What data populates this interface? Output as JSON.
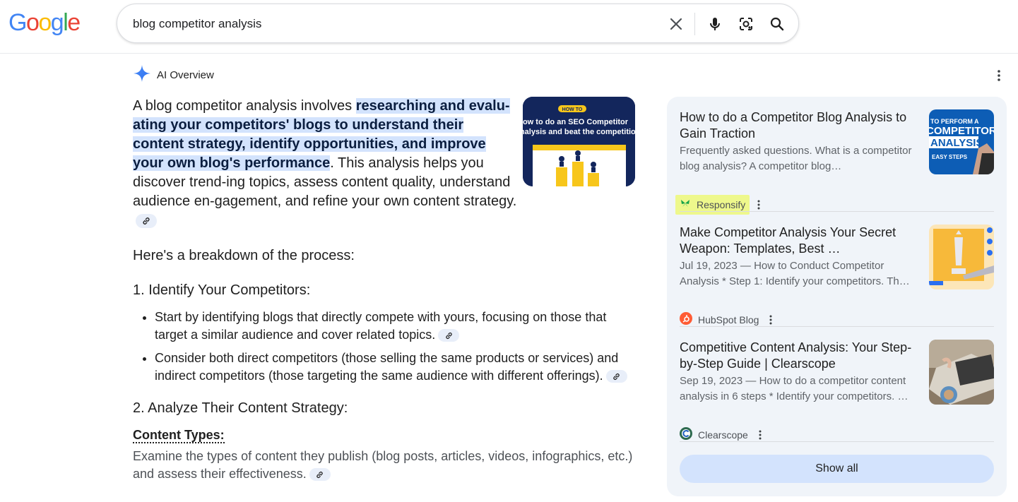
{
  "brand": {
    "logo_letters": [
      "G",
      "o",
      "o",
      "g",
      "l",
      "e"
    ],
    "logo_colors": [
      "#4285f4",
      "#ea4335",
      "#fbbc05",
      "#4285f4",
      "#34a853",
      "#ea4335"
    ]
  },
  "search": {
    "query": "blog competitor analysis",
    "icons": [
      "close-icon",
      "microphone-icon",
      "lens-icon",
      "search-icon"
    ]
  },
  "ai_overview": {
    "title": "AI Overview",
    "intro_prefix": "A blog competitor analysis involves ",
    "intro_highlight": "researching and evalu-ating your competitors' blogs to understand their content strategy, identify opportunities, and improve your own blog's performance",
    "intro_suffix": ". This analysis helps you discover trend-ing topics, assess content quality, understand audience en-gagement, and refine your own content strategy.",
    "breakdown_heading": "Here's a breakdown of the process:",
    "step1_heading": "1. Identify Your Competitors:",
    "step1_bullets": [
      "Start by identifying blogs that directly compete with yours, focusing on those that target a similar audience and cover related topics.",
      "Consider both direct competitors (those selling the same products or services) and indirect competitors (those targeting the same audience with different offerings)."
    ],
    "step2_heading": "2. Analyze Their Content Strategy:",
    "content_types_heading": "Content Types:",
    "content_types_text": "Examine the types of content they publish (blog posts, articles, videos, infographics, etc.) and assess their effectiveness.",
    "image_text": {
      "badge": "HOW TO",
      "line1": "How to do an SEO Competitor",
      "line2": "Analysis and beat the competition"
    }
  },
  "sources": [
    {
      "title": "How to do a Competitor Blog Analysis to Gain Traction",
      "snippet": "Frequently asked questions. What is a competitor blog analysis? A competitor blog…",
      "source": "Responsify",
      "thumb_text": [
        "TO PERFORM A",
        "COMPETITOR",
        "ANALYSIS",
        "EASY STEPS"
      ]
    },
    {
      "title": "Make Competitor Analysis Your Secret Weapon: Templates, Best …",
      "snippet": "Jul 19, 2023 — How to Conduct Competitor Analysis * Step 1: Identify your competitors. Th…",
      "source": "HubSpot Blog"
    },
    {
      "title": "Competitive Content Analysis: Your Step-by-Step Guide | Clearscope",
      "snippet": "Sep 19, 2023 — How to do a competitor content analysis in 6 steps * Identify your competitors. …",
      "source": "Clearscope"
    }
  ],
  "show_all_label": "Show all",
  "colors": {
    "highlight": "#d3e3fd",
    "panel_bg": "#f0f4f9",
    "responsify_highlight": "#eef88c"
  }
}
